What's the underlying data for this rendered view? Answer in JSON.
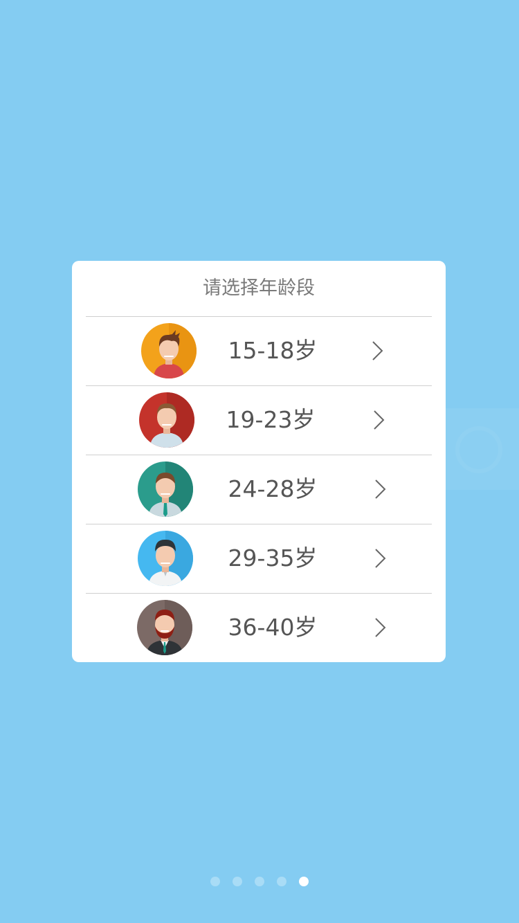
{
  "dialog": {
    "title": "请选择年龄段",
    "options": [
      {
        "label": "15-18岁",
        "avatar_icon": "avatar-teen-icon",
        "bg": "#F3A21B"
      },
      {
        "label": "19-23岁",
        "avatar_icon": "avatar-young-man-icon",
        "bg": "#C4332B"
      },
      {
        "label": "24-28岁",
        "avatar_icon": "avatar-man-tie-icon",
        "bg": "#2B9C8C"
      },
      {
        "label": "29-35岁",
        "avatar_icon": "avatar-man-shirt-icon",
        "bg": "#45B8F0"
      },
      {
        "label": "36-40岁",
        "avatar_icon": "avatar-bearded-man-icon",
        "bg": "#7C6A66"
      }
    ]
  },
  "pager": {
    "total": 5,
    "active_index": 4
  },
  "colors": {
    "background": "#84CCF2",
    "card": "#FFFFFF",
    "text": "#555555",
    "title_text": "#7A7A7A"
  }
}
